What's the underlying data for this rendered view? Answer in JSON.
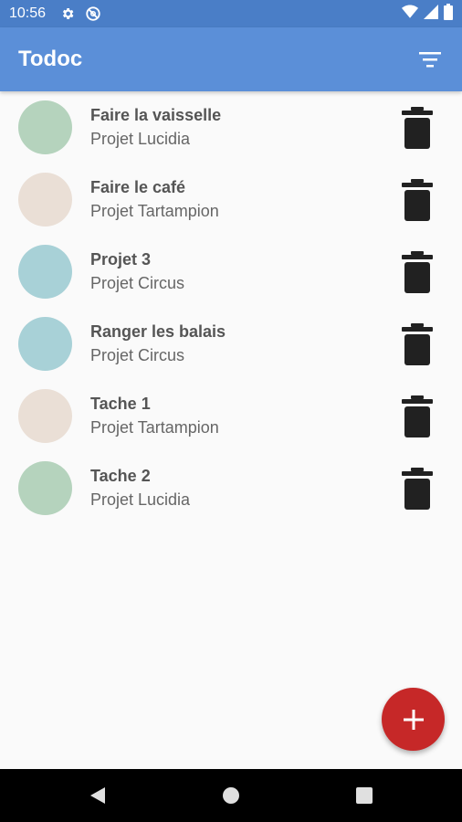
{
  "status_bar": {
    "time": "10:56",
    "icons": [
      "gear-icon",
      "no-disturb-icon"
    ],
    "right_icons": [
      "wifi-icon",
      "signal-icon",
      "battery-icon"
    ]
  },
  "app_bar": {
    "title": "Todoc",
    "filter_icon": "filter-icon",
    "color": "#5b8fd8"
  },
  "tasks": [
    {
      "name": "Faire la vaisselle",
      "project": "Projet Lucidia",
      "color": "#b5d3bd"
    },
    {
      "name": "Faire le café",
      "project": "Projet Tartampion",
      "color": "#eadfd6"
    },
    {
      "name": "Projet 3",
      "project": "Projet Circus",
      "color": "#a8d1d7"
    },
    {
      "name": "Ranger les balais",
      "project": "Projet Circus",
      "color": "#a8d1d7"
    },
    {
      "name": "Tache 1",
      "project": "Projet Tartampion",
      "color": "#eadfd6"
    },
    {
      "name": "Tache 2",
      "project": "Projet Lucidia",
      "color": "#b5d3bd"
    }
  ],
  "fab": {
    "label": "+",
    "color": "#c62828"
  },
  "nav_bar": {
    "icons": [
      "back-icon",
      "home-icon",
      "recents-icon"
    ]
  }
}
